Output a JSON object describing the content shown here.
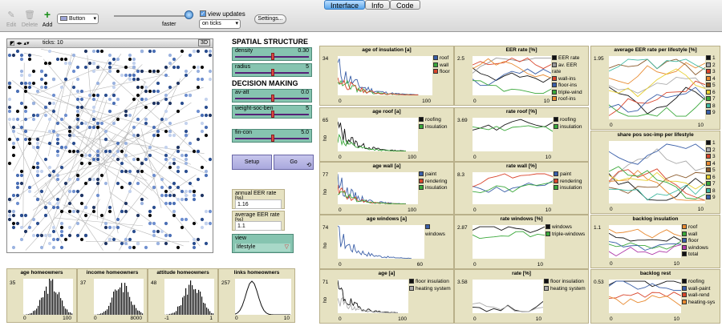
{
  "toolbar": {
    "edit": "Edit",
    "delete": "Delete",
    "add": "Add",
    "widget_type": "Button",
    "speed_label": "faster",
    "view_updates": "view updates",
    "update_mode": "on ticks",
    "settings": "Settings..."
  },
  "tabs": [
    {
      "label": "Interface",
      "active": true
    },
    {
      "label": "Info",
      "active": false
    },
    {
      "label": "Code",
      "active": false
    }
  ],
  "world": {
    "ticks": "ticks: 10",
    "view3d": "3D"
  },
  "spatial": {
    "title": "SPATIAL STRUCTURE",
    "density": {
      "name": "density",
      "value": "0.30",
      "level": 0.3
    },
    "radius": {
      "name": "radius",
      "value": "5",
      "level": 0.3
    }
  },
  "decision": {
    "title": "DECISION MAKING",
    "avatt": {
      "name": "av-att",
      "value": "0.0",
      "level": 0.5
    },
    "wsb": {
      "name": "weight-soc-ben",
      "value": "5",
      "level": 0.5
    },
    "fincon": {
      "name": "fin-con",
      "value": "5.0",
      "level": 0.5
    }
  },
  "buttons": {
    "setup": "Setup",
    "go": "Go"
  },
  "monitors": {
    "annual": {
      "label": "annual EER rate [%]",
      "value": "1.16"
    },
    "average": {
      "label": "average EER rate [%]",
      "value": "1.1"
    }
  },
  "chooser": {
    "label": "view",
    "value": "lifestyle"
  },
  "histograms": [
    {
      "title": "age homeowners",
      "ymax": "35",
      "xmin": "0",
      "xmax": "100"
    },
    {
      "title": "income homeowners",
      "ymax": "37",
      "xmin": "0",
      "xmax": "8000"
    },
    {
      "title": "attitude homeowners",
      "ymax": "48",
      "xmin": "-1",
      "xmax": "1"
    },
    {
      "title": "links homeowners",
      "ymax": "257",
      "xmin": "0",
      "xmax": "10"
    }
  ],
  "plots": [
    {
      "id": "p1",
      "title": "age of insulation [a]",
      "ymax": "34",
      "xmin": "0",
      "xmax": "100",
      "legend": [
        {
          "n": "roof",
          "c": "#3a5fa8"
        },
        {
          "n": "wall",
          "c": "#3aa83a"
        },
        {
          "n": "floor",
          "c": "#d9452b"
        }
      ]
    },
    {
      "id": "p2",
      "title": "EER rate [%]",
      "ymax": "2.5",
      "xmin": "0",
      "xmax": "10",
      "legend": [
        {
          "n": "EER rate",
          "c": "#111"
        },
        {
          "n": "av. EER rate",
          "c": "#999"
        },
        {
          "n": "wall-ins",
          "c": "#d9452b"
        },
        {
          "n": "floor-ins",
          "c": "#3a5fa8"
        },
        {
          "n": "triple-wind",
          "c": "#3aa83a"
        },
        {
          "n": "roof-ins",
          "c": "#e88a30"
        }
      ]
    },
    {
      "id": "p3",
      "title": "age roof [a]",
      "ymax": "65",
      "xmin": "0",
      "xmax": "100",
      "ylabel": "ho",
      "legend": [
        {
          "n": "roofing",
          "c": "#111"
        },
        {
          "n": "insulation",
          "c": "#3aa83a"
        }
      ]
    },
    {
      "id": "p4",
      "title": "rate roof [%]",
      "ymax": "3.69",
      "xmin": "0",
      "xmax": "10",
      "legend": [
        {
          "n": "roofing",
          "c": "#111"
        },
        {
          "n": "insulation",
          "c": "#3aa83a"
        }
      ]
    },
    {
      "id": "p5",
      "title": "age wall [a]",
      "ymax": "77",
      "xmin": "0",
      "xmax": "100",
      "ylabel": "ho",
      "legend": [
        {
          "n": "paint",
          "c": "#3a5fa8"
        },
        {
          "n": "rendering",
          "c": "#d9452b"
        },
        {
          "n": "insulation",
          "c": "#3aa83a"
        }
      ]
    },
    {
      "id": "p6",
      "title": "rate wall [%]",
      "ymax": "8.3",
      "xmin": "0",
      "xmax": "10",
      "legend": [
        {
          "n": "paint",
          "c": "#3a5fa8"
        },
        {
          "n": "rendering",
          "c": "#d9452b"
        },
        {
          "n": "insulation",
          "c": "#3aa83a"
        }
      ]
    },
    {
      "id": "p7",
      "title": "age windows [a]",
      "ymax": "74",
      "xmin": "0",
      "xmax": "60",
      "ylabel": "ho",
      "legend": [
        {
          "n": "windows",
          "c": "#3a5fa8"
        }
      ]
    },
    {
      "id": "p8",
      "title": "rate windows [%]",
      "ymax": "2.87",
      "xmin": "0",
      "xmax": "10",
      "legend": [
        {
          "n": "windows",
          "c": "#111"
        },
        {
          "n": "triple-windows",
          "c": "#3aa83a"
        }
      ]
    },
    {
      "id": "p9",
      "title": "age [a]",
      "ymax": "71",
      "xmin": "0",
      "xmax": "100",
      "ylabel": "ho",
      "legend": [
        {
          "n": "floor insulation",
          "c": "#111"
        },
        {
          "n": "heating system",
          "c": "#aaa"
        }
      ]
    },
    {
      "id": "p10",
      "title": "rate [%]",
      "ymax": "3.58",
      "xmin": "0",
      "xmax": "10",
      "legend": [
        {
          "n": "floor insulation",
          "c": "#111"
        },
        {
          "n": "heating system",
          "c": "#aaa"
        }
      ]
    }
  ],
  "lifestyle_plots": [
    {
      "title": "average EER rate per lifestyle  [%]",
      "ymax": "1.95",
      "xmin": "0",
      "xmax": "10"
    },
    {
      "title": "share pos soc-imp per lifestyle",
      "ymax": "",
      "xmin": "0",
      "xmax": "10"
    }
  ],
  "lifestyle_legend": [
    {
      "n": "1",
      "c": "#111"
    },
    {
      "n": "2",
      "c": "#aaa"
    },
    {
      "n": "3",
      "c": "#d9452b"
    },
    {
      "n": "4",
      "c": "#e88a30"
    },
    {
      "n": "5",
      "c": "#8a5a2b"
    },
    {
      "n": "6",
      "c": "#e8d030"
    },
    {
      "n": "7",
      "c": "#3aa83a"
    },
    {
      "n": "8",
      "c": "#40b8a0"
    },
    {
      "n": "9",
      "c": "#3a5fa8"
    }
  ],
  "backlog": [
    {
      "title": "backlog insulation",
      "ymax": "1.1",
      "xmin": "0",
      "xmax": "10",
      "legend": [
        {
          "n": "roof",
          "c": "#e88a30"
        },
        {
          "n": "wall",
          "c": "#3aa83a"
        },
        {
          "n": "floor",
          "c": "#3a5fa8"
        },
        {
          "n": "windows",
          "c": "#b03aa8"
        },
        {
          "n": "total",
          "c": "#111"
        }
      ]
    },
    {
      "title": "backlog rest",
      "ymax": "0.53",
      "xmin": "0",
      "xmax": "10",
      "legend": [
        {
          "n": "roofing",
          "c": "#111"
        },
        {
          "n": "wall-paint",
          "c": "#3a5fa8"
        },
        {
          "n": "wall-rend",
          "c": "#d9452b"
        },
        {
          "n": "heating-sys",
          "c": "#e88a30"
        }
      ]
    }
  ]
}
